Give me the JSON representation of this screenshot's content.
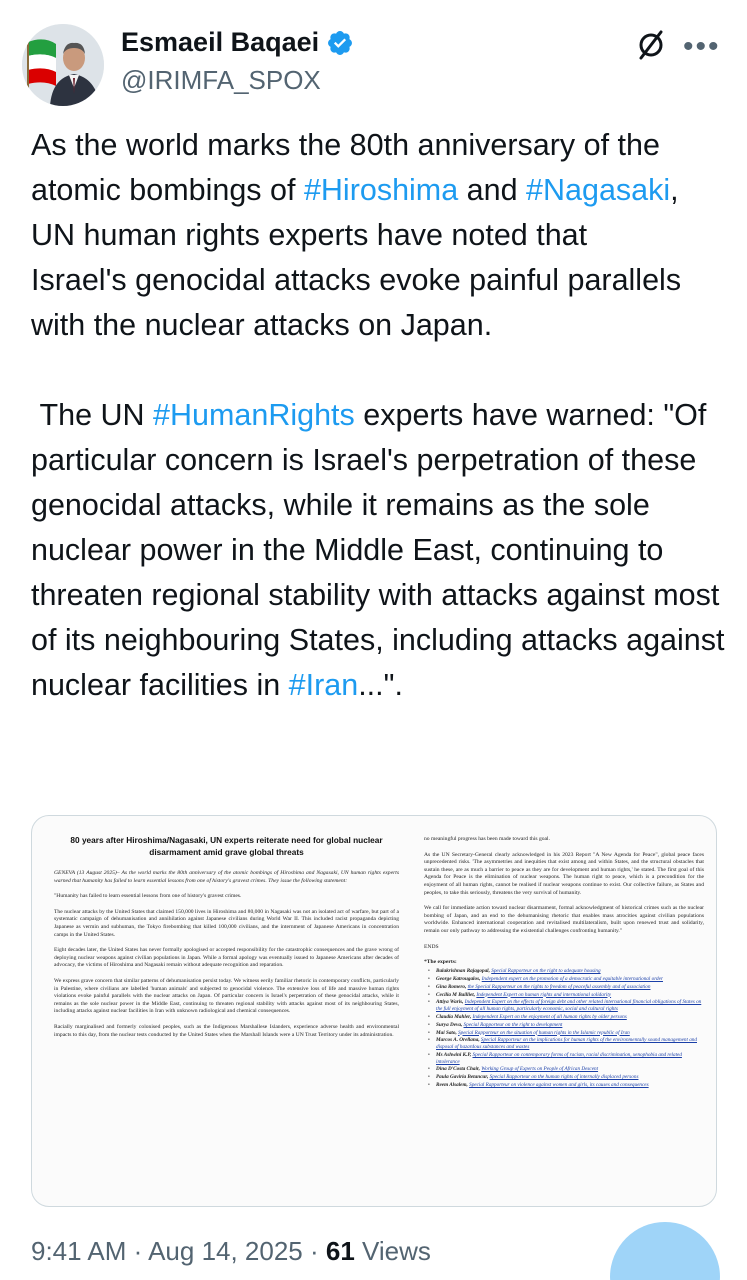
{
  "author": {
    "name": "Esmaeil Baqaei",
    "handle": "@IRIMFA_SPOX"
  },
  "tweet": {
    "p1": [
      {
        "t": "As the world marks the 80th anniversary of the atomic bombings of "
      },
      {
        "t": "#Hiroshima",
        "tag": true
      },
      {
        "t": " and "
      },
      {
        "t": "#Nagasaki",
        "tag": true
      },
      {
        "t": ", UN human rights experts have noted that\nIsrael's genocidal attacks evoke painful parallels with the nuclear attacks on Japan."
      }
    ],
    "p2": [
      {
        "t": " The UN "
      },
      {
        "t": "#HumanRights",
        "tag": true
      },
      {
        "t": " experts have warned: \"Of particular concern is Israel's perpetration of these genocidal attacks, while it remains as the sole nuclear power in the Middle East, continuing to threaten regional stability with attacks against most of its neighbouring States, including attacks against nuclear facilities in "
      },
      {
        "t": "#Iran",
        "tag": true
      },
      {
        "t": "...\"."
      }
    ]
  },
  "document": {
    "title": "80 years after Hiroshima/Nagasaki, UN experts reiterate need for global nuclear disarmament amid grave global threats",
    "left_paragraphs": [
      {
        "text": "GENEVA (13 August 2025)– As the world marks the 80th anniversary of the atomic bombings of Hiroshima and Nagasaki, UN human rights experts warned that humanity has failed to learn essential lessons from one of history's gravest crimes. They issue the following statement:",
        "italic": true
      },
      {
        "text": "\"Humanity has failed to learn essential lessons from one of history's gravest crimes."
      },
      {
        "text": "The nuclear attacks by the United States that claimed 150,000 lives in Hiroshima and 80,000 in Nagasaki was not an isolated act of warfare, but part of a systematic campaign of dehumanisation and annihilation against Japanese civilians during World War II. This included racist propaganda depicting Japanese as vermin and subhuman, the Tokyo firebombing that killed 100,000 civilians, and the internment of Japanese Americans in concentration camps in the United States."
      },
      {
        "text": "Eight decades later, the United States has never formally apologised or accepted responsibility for the catastrophic consequences and the grave wrong of deploying nuclear weapons against civilian populations in Japan. While a formal apology was eventually issued to Japanese Americans after decades of advocacy, the victims of Hiroshima and Nagasaki remain without adequate recognition and reparation."
      },
      {
        "text": "We express grave concern that similar patterns of dehumanisation persist today. We witness eerily familiar rhetoric in contemporary conflicts, particularly in Palestine, where civilians are labelled 'human animals' and subjected to genocidal violence. The extensive loss of life and massive human rights violations evoke painful parallels with the nuclear attacks on Japan. Of particular concern is Israel's perpetration of these genocidal attacks, while it remains as the sole nuclear power in the Middle East, continuing to threaten regional stability with attacks against most of its neighbouring States, including attacks against nuclear facilities in Iran with unknown radiological and chemical consequences."
      },
      {
        "text": "Racially marginalised and formerly colonised peoples, such as the Indigenous Marshallese Islanders, experience adverse health and environmental impacts to this day, from the nuclear tests conducted by the United States when the Marshall Islands were a UN Trust Territory under its administration."
      }
    ],
    "right_paragraphs": [
      {
        "text": "no meaningful progress has been made toward this goal."
      },
      {
        "text": "As the UN Secretary-General clearly acknowledged in his 2023 Report \"A New Agenda for Peace\", global peace faces unprecedented risks. 'The asymmetries and inequities that exist among and within States, and the structural obstacles that sustain these, are as much a barrier to peace as they are for development and human rights,' he stated. The first goal of this Agenda for Peace is the elimination of nuclear weapons. The human right to peace, which is a precondition for the enjoyment of all human rights, cannot be realised if nuclear weapons continue to exist. Our collective failure, as States and peoples, to take this seriously, threatens the very survival of humanity."
      },
      {
        "text": "We call for immediate action toward nuclear disarmament, formal acknowledgment of historical crimes such as the nuclear bombing of Japan, and an end to the dehumanising rhetoric that enables mass atrocities against civilian populations worldwide. Enhanced international cooperation and revitalised multilateralism, built upon renewed trust and solidarity, remain our only pathway to addressing the existential challenges confronting humanity.\""
      },
      {
        "text": "ENDS"
      }
    ],
    "experts_title": "*The experts:",
    "experts": [
      {
        "name": "Balakrishnan Rajagopal",
        "role": "Special Rapporteur on the right to adequate housing"
      },
      {
        "name": "George Katrougalos",
        "role": "Independent expert on the promotion of a democratic and equitable international order"
      },
      {
        "name": "Gina Romero",
        "role": "the Special Rapporteur on the rights to freedom of peaceful assembly and of association"
      },
      {
        "name": "Cecilia M Bailliet",
        "role": "Independent Expert on human rights and international solidarity"
      },
      {
        "name": "Attiya Waris",
        "role": "Independent Expert on the effects of foreign debt and other related international financial obligations of States on the full enjoyment of all human rights, particularly economic, social and cultural rights"
      },
      {
        "name": "Claudia Mahler",
        "role": "Independent Expert on the enjoyment of all human rights by older persons"
      },
      {
        "name": "Surya Deva",
        "role": "Special Rapporteur on the right to development"
      },
      {
        "name": "Mai Sato",
        "role": "Special Rapporteur on the situation of human rights in the Islamic republic of Iran"
      },
      {
        "name": "Marcos A. Orellana",
        "role": "Special Rapporteur on the implications for human rights of the environmentally sound management and disposal of hazardous substances and wastes"
      },
      {
        "name": "Ms Ashwini K.P",
        "role": "Special Rapporteur on contemporary forms of racism, racial discrimination, xenophobia and related intolerance"
      },
      {
        "name": "Dina D'Costa Chair",
        "role": "Working Group of Experts on People of African Descent"
      },
      {
        "name": "Paula Gaviria Betancur",
        "role": "Special Rapporteur on the human rights of internally displaced persons"
      },
      {
        "name": "Reem Alsalem",
        "role": "Special Rapporteur on violence against women and girls, its causes and consequences"
      }
    ]
  },
  "meta": {
    "time": "9:41 AM",
    "sep1": " · ",
    "date": "Aug 14, 2025",
    "sep2": " · ",
    "views_count": "61",
    "views_label": " Views"
  },
  "colors": {
    "link": "#1d9bf0",
    "text": "#0f1419",
    "muted": "#536471",
    "verified": "#1d9bf0"
  },
  "icons": [
    "verified-badge-icon",
    "grok-icon",
    "more-icon",
    "iran-flag-icon"
  ]
}
